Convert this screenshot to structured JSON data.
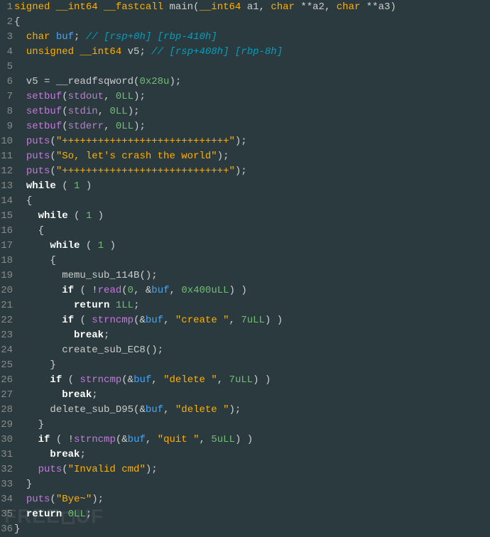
{
  "lines": [
    {
      "n": "1",
      "segs": [
        [
          "kw-type",
          "signed"
        ],
        [
          "",
          " "
        ],
        [
          "kw-type",
          "__int64"
        ],
        [
          "",
          " "
        ],
        [
          "kw-type",
          "__fastcall"
        ],
        [
          "",
          " "
        ],
        [
          "fn-alt",
          "main"
        ],
        [
          "paren",
          "("
        ],
        [
          "kw-type",
          "__int64"
        ],
        [
          "",
          " a1"
        ],
        [
          "paren",
          ","
        ],
        [
          "",
          " "
        ],
        [
          "kw-type",
          "char"
        ],
        [
          "",
          " **a2"
        ],
        [
          "paren",
          ","
        ],
        [
          "",
          " "
        ],
        [
          "kw-type",
          "char"
        ],
        [
          "",
          " **a3"
        ],
        [
          "paren",
          ")"
        ]
      ]
    },
    {
      "n": "2",
      "segs": [
        [
          "brace",
          "{"
        ]
      ]
    },
    {
      "n": "3",
      "segs": [
        [
          "",
          "  "
        ],
        [
          "kw-type",
          "char"
        ],
        [
          "",
          " "
        ],
        [
          "buf",
          "buf"
        ],
        [
          "op",
          ";"
        ],
        [
          "",
          " "
        ],
        [
          "comment",
          "// [rsp+0h] [rbp-410h]"
        ]
      ]
    },
    {
      "n": "4",
      "segs": [
        [
          "",
          "  "
        ],
        [
          "kw-type",
          "unsigned __int64"
        ],
        [
          "",
          " v5"
        ],
        [
          "op",
          ";"
        ],
        [
          "",
          " "
        ],
        [
          "comment",
          "// [rsp+408h] [rbp-8h]"
        ]
      ]
    },
    {
      "n": "5",
      "segs": [
        [
          "",
          ""
        ]
      ]
    },
    {
      "n": "6",
      "segs": [
        [
          "",
          "  v5 "
        ],
        [
          "op",
          "="
        ],
        [
          "",
          " "
        ],
        [
          "fn-alt",
          "__readfsqword"
        ],
        [
          "paren",
          "("
        ],
        [
          "num",
          "0x28u"
        ],
        [
          "paren",
          ")"
        ],
        [
          "op",
          ";"
        ]
      ]
    },
    {
      "n": "7",
      "segs": [
        [
          "",
          "  "
        ],
        [
          "fn",
          "setbuf"
        ],
        [
          "paren",
          "("
        ],
        [
          "std",
          "stdout"
        ],
        [
          "paren",
          ","
        ],
        [
          "",
          " "
        ],
        [
          "num",
          "0LL"
        ],
        [
          "paren",
          ")"
        ],
        [
          "op",
          ";"
        ]
      ]
    },
    {
      "n": "8",
      "segs": [
        [
          "",
          "  "
        ],
        [
          "fn",
          "setbuf"
        ],
        [
          "paren",
          "("
        ],
        [
          "std",
          "stdin"
        ],
        [
          "paren",
          ","
        ],
        [
          "",
          " "
        ],
        [
          "num",
          "0LL"
        ],
        [
          "paren",
          ")"
        ],
        [
          "op",
          ";"
        ]
      ]
    },
    {
      "n": "9",
      "segs": [
        [
          "",
          "  "
        ],
        [
          "fn",
          "setbuf"
        ],
        [
          "paren",
          "("
        ],
        [
          "std",
          "stderr"
        ],
        [
          "paren",
          ","
        ],
        [
          "",
          " "
        ],
        [
          "num",
          "0LL"
        ],
        [
          "paren",
          ")"
        ],
        [
          "op",
          ";"
        ]
      ]
    },
    {
      "n": "10",
      "segs": [
        [
          "",
          "  "
        ],
        [
          "fn",
          "puts"
        ],
        [
          "paren",
          "("
        ],
        [
          "str",
          "\"++++++++++++++++++++++++++++\""
        ],
        [
          "paren",
          ")"
        ],
        [
          "op",
          ";"
        ]
      ]
    },
    {
      "n": "11",
      "segs": [
        [
          "",
          "  "
        ],
        [
          "fn",
          "puts"
        ],
        [
          "paren",
          "("
        ],
        [
          "str",
          "\"So, let's crash the world\""
        ],
        [
          "paren",
          ")"
        ],
        [
          "op",
          ";"
        ]
      ]
    },
    {
      "n": "12",
      "segs": [
        [
          "",
          "  "
        ],
        [
          "fn",
          "puts"
        ],
        [
          "paren",
          "("
        ],
        [
          "str",
          "\"++++++++++++++++++++++++++++\""
        ],
        [
          "paren",
          ")"
        ],
        [
          "op",
          ";"
        ]
      ]
    },
    {
      "n": "13",
      "segs": [
        [
          "",
          "  "
        ],
        [
          "kw-ctrl",
          "while"
        ],
        [
          "",
          " "
        ],
        [
          "paren",
          "("
        ],
        [
          "",
          " "
        ],
        [
          "num",
          "1"
        ],
        [
          "",
          " "
        ],
        [
          "paren",
          ")"
        ]
      ]
    },
    {
      "n": "14",
      "segs": [
        [
          "",
          "  "
        ],
        [
          "brace",
          "{"
        ]
      ]
    },
    {
      "n": "15",
      "segs": [
        [
          "",
          "    "
        ],
        [
          "kw-ctrl",
          "while"
        ],
        [
          "",
          " "
        ],
        [
          "paren",
          "("
        ],
        [
          "",
          " "
        ],
        [
          "num",
          "1"
        ],
        [
          "",
          " "
        ],
        [
          "paren",
          ")"
        ]
      ]
    },
    {
      "n": "16",
      "segs": [
        [
          "",
          "    "
        ],
        [
          "brace",
          "{"
        ]
      ]
    },
    {
      "n": "17",
      "segs": [
        [
          "",
          "      "
        ],
        [
          "kw-ctrl",
          "while"
        ],
        [
          "",
          " "
        ],
        [
          "paren",
          "("
        ],
        [
          "",
          " "
        ],
        [
          "num",
          "1"
        ],
        [
          "",
          " "
        ],
        [
          "paren",
          ")"
        ]
      ]
    },
    {
      "n": "18",
      "segs": [
        [
          "",
          "      "
        ],
        [
          "brace",
          "{"
        ]
      ]
    },
    {
      "n": "19",
      "segs": [
        [
          "",
          "        "
        ],
        [
          "fn-alt",
          "memu_sub_114B"
        ],
        [
          "paren",
          "()"
        ],
        [
          "op",
          ";"
        ]
      ]
    },
    {
      "n": "20",
      "segs": [
        [
          "",
          "        "
        ],
        [
          "kw-ctrl",
          "if"
        ],
        [
          "",
          " "
        ],
        [
          "paren",
          "("
        ],
        [
          "",
          " "
        ],
        [
          "op",
          "!"
        ],
        [
          "fn",
          "read"
        ],
        [
          "paren",
          "("
        ],
        [
          "num",
          "0"
        ],
        [
          "paren",
          ","
        ],
        [
          "",
          " "
        ],
        [
          "op",
          "&"
        ],
        [
          "buf",
          "buf"
        ],
        [
          "paren",
          ","
        ],
        [
          "",
          " "
        ],
        [
          "num",
          "0x400uLL"
        ],
        [
          "paren",
          ")"
        ],
        [
          "",
          " "
        ],
        [
          "paren",
          ")"
        ]
      ]
    },
    {
      "n": "21",
      "segs": [
        [
          "",
          "          "
        ],
        [
          "kw-ctrl",
          "return"
        ],
        [
          "",
          " "
        ],
        [
          "num",
          "1LL"
        ],
        [
          "op",
          ";"
        ]
      ]
    },
    {
      "n": "22",
      "segs": [
        [
          "",
          "        "
        ],
        [
          "kw-ctrl",
          "if"
        ],
        [
          "",
          " "
        ],
        [
          "paren",
          "("
        ],
        [
          "",
          " "
        ],
        [
          "fn",
          "strncmp"
        ],
        [
          "paren",
          "("
        ],
        [
          "op",
          "&"
        ],
        [
          "buf",
          "buf"
        ],
        [
          "paren",
          ","
        ],
        [
          "",
          " "
        ],
        [
          "str",
          "\"create \""
        ],
        [
          "paren",
          ","
        ],
        [
          "",
          " "
        ],
        [
          "num",
          "7uLL"
        ],
        [
          "paren",
          ")"
        ],
        [
          "",
          " "
        ],
        [
          "paren",
          ")"
        ]
      ]
    },
    {
      "n": "23",
      "segs": [
        [
          "",
          "          "
        ],
        [
          "kw-ctrl",
          "break"
        ],
        [
          "op",
          ";"
        ]
      ]
    },
    {
      "n": "24",
      "segs": [
        [
          "",
          "        "
        ],
        [
          "fn-alt",
          "create_sub_EC8"
        ],
        [
          "paren",
          "()"
        ],
        [
          "op",
          ";"
        ]
      ]
    },
    {
      "n": "25",
      "segs": [
        [
          "",
          "      "
        ],
        [
          "brace",
          "}"
        ]
      ]
    },
    {
      "n": "26",
      "segs": [
        [
          "",
          "      "
        ],
        [
          "kw-ctrl",
          "if"
        ],
        [
          "",
          " "
        ],
        [
          "paren",
          "("
        ],
        [
          "",
          " "
        ],
        [
          "fn",
          "strncmp"
        ],
        [
          "paren",
          "("
        ],
        [
          "op",
          "&"
        ],
        [
          "buf",
          "buf"
        ],
        [
          "paren",
          ","
        ],
        [
          "",
          " "
        ],
        [
          "str",
          "\"delete \""
        ],
        [
          "paren",
          ","
        ],
        [
          "",
          " "
        ],
        [
          "num",
          "7uLL"
        ],
        [
          "paren",
          ")"
        ],
        [
          "",
          " "
        ],
        [
          "paren",
          ")"
        ]
      ]
    },
    {
      "n": "27",
      "segs": [
        [
          "",
          "        "
        ],
        [
          "kw-ctrl",
          "break"
        ],
        [
          "op",
          ";"
        ]
      ]
    },
    {
      "n": "28",
      "segs": [
        [
          "",
          "      "
        ],
        [
          "fn-alt",
          "delete_sub_D95"
        ],
        [
          "paren",
          "("
        ],
        [
          "op",
          "&"
        ],
        [
          "buf",
          "buf"
        ],
        [
          "paren",
          ","
        ],
        [
          "",
          " "
        ],
        [
          "str",
          "\"delete \""
        ],
        [
          "paren",
          ")"
        ],
        [
          "op",
          ";"
        ]
      ]
    },
    {
      "n": "29",
      "segs": [
        [
          "",
          "    "
        ],
        [
          "brace",
          "}"
        ]
      ]
    },
    {
      "n": "30",
      "segs": [
        [
          "",
          "    "
        ],
        [
          "kw-ctrl",
          "if"
        ],
        [
          "",
          " "
        ],
        [
          "paren",
          "("
        ],
        [
          "",
          " "
        ],
        [
          "op",
          "!"
        ],
        [
          "fn",
          "strncmp"
        ],
        [
          "paren",
          "("
        ],
        [
          "op",
          "&"
        ],
        [
          "buf",
          "buf"
        ],
        [
          "paren",
          ","
        ],
        [
          "",
          " "
        ],
        [
          "str",
          "\"quit \""
        ],
        [
          "paren",
          ","
        ],
        [
          "",
          " "
        ],
        [
          "num",
          "5uLL"
        ],
        [
          "paren",
          ")"
        ],
        [
          "",
          " "
        ],
        [
          "paren",
          ")"
        ]
      ]
    },
    {
      "n": "31",
      "segs": [
        [
          "",
          "      "
        ],
        [
          "kw-ctrl",
          "break"
        ],
        [
          "op",
          ";"
        ]
      ]
    },
    {
      "n": "32",
      "segs": [
        [
          "",
          "    "
        ],
        [
          "fn",
          "puts"
        ],
        [
          "paren",
          "("
        ],
        [
          "str",
          "\"Invalid cmd\""
        ],
        [
          "paren",
          ")"
        ],
        [
          "op",
          ";"
        ]
      ]
    },
    {
      "n": "33",
      "segs": [
        [
          "",
          "  "
        ],
        [
          "brace",
          "}"
        ]
      ]
    },
    {
      "n": "34",
      "segs": [
        [
          "",
          "  "
        ],
        [
          "fn",
          "puts"
        ],
        [
          "paren",
          "("
        ],
        [
          "str",
          "\"Bye~\""
        ],
        [
          "paren",
          ")"
        ],
        [
          "op",
          ";"
        ]
      ]
    },
    {
      "n": "35",
      "segs": [
        [
          "",
          "  "
        ],
        [
          "kw-ctrl",
          "return"
        ],
        [
          "",
          " "
        ],
        [
          "num",
          "0LL"
        ],
        [
          "op",
          ";"
        ]
      ]
    },
    {
      "n": "36",
      "segs": [
        [
          "brace",
          "}"
        ]
      ]
    }
  ],
  "watermark": "FREEBUF"
}
